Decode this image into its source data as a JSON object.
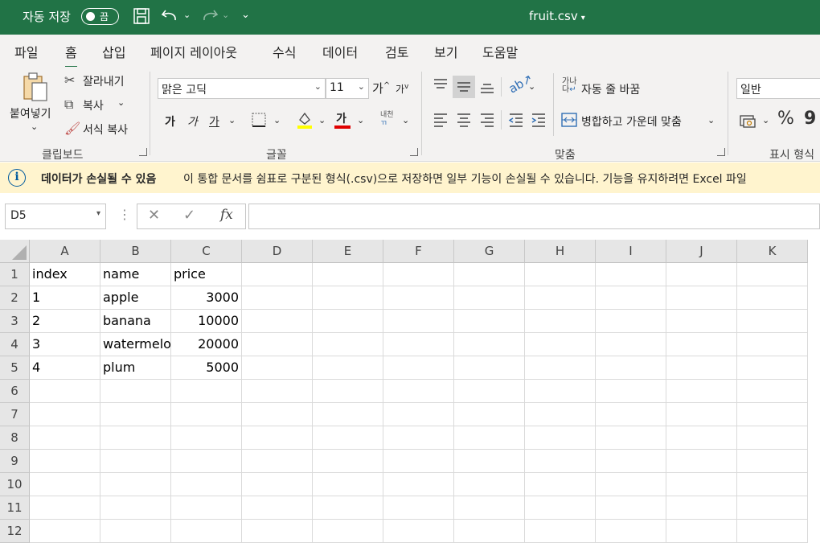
{
  "titlebar": {
    "autosave_label": "자동 저장",
    "autosave_state": "끔",
    "file_name": "fruit.csv",
    "bg_color": "#217346"
  },
  "tabs": [
    "파일",
    "홈",
    "삽입",
    "페이지 레이아웃",
    "수식",
    "데이터",
    "검토",
    "보기",
    "도움말"
  ],
  "active_tab": "홈",
  "ribbon": {
    "clipboard": {
      "paste": "붙여넣기",
      "cut": "잘라내기",
      "copy": "복사",
      "format_painter": "서식 복사",
      "label": "클립보드"
    },
    "font": {
      "font_name": "맑은 고딕",
      "font_size": "11",
      "grow": "가",
      "shrink": "가",
      "bold": "가",
      "italic": "가",
      "underline": "가",
      "font_color": "가",
      "phonetic": "내천",
      "label": "글꼴"
    },
    "alignment": {
      "wrap_text": "자동 줄 바꿈",
      "merge_center": "병합하고 가운데 맞춤",
      "label": "맞춤"
    },
    "number": {
      "format": "일반",
      "percent": "%",
      "comma": "9",
      "label": "표시 형식"
    }
  },
  "infobar": {
    "title": "데이터가 손실될 수 있음",
    "message": "이 통합 문서를 쉼표로 구분된 형식(.csv)으로 저장하면 일부 기능이 손실될 수 있습니다. 기능을 유지하려면 Excel 파일"
  },
  "formula_bar": {
    "name_box": "D5",
    "fx": "fx",
    "formula": ""
  },
  "sheet": {
    "columns": [
      "A",
      "B",
      "C",
      "D",
      "E",
      "F",
      "G",
      "H",
      "I",
      "J",
      "K"
    ],
    "rows": [
      "1",
      "2",
      "3",
      "4",
      "5",
      "6",
      "7",
      "8",
      "9",
      "10",
      "11",
      "12"
    ],
    "cells": [
      [
        "index",
        "name",
        "price"
      ],
      [
        "1",
        "apple",
        "3000"
      ],
      [
        "2",
        "banana",
        "10000"
      ],
      [
        "3",
        "watermelo",
        "20000"
      ],
      [
        "4",
        "plum",
        "5000"
      ]
    ]
  }
}
